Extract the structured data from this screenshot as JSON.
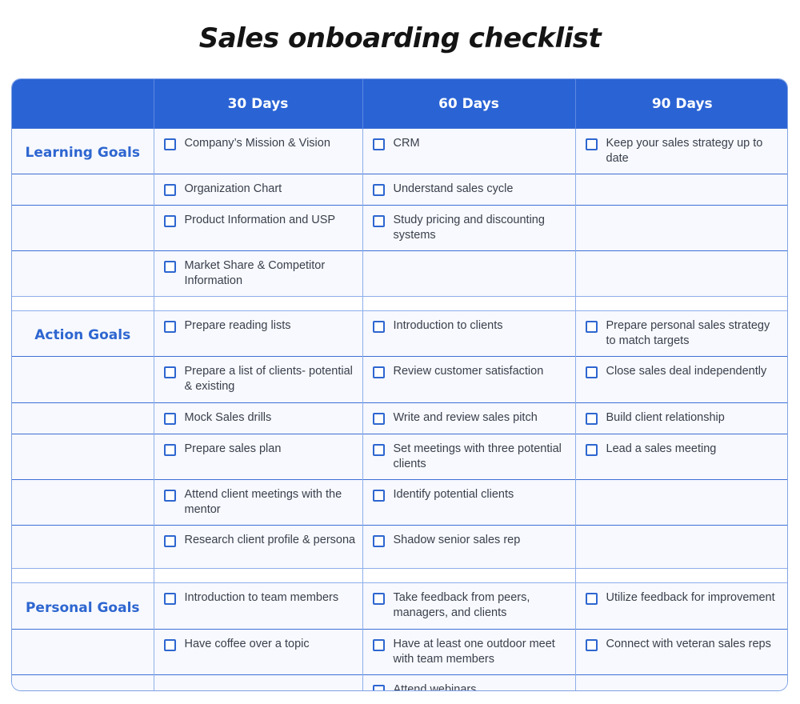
{
  "title": "Sales onboarding checklist",
  "columns": [
    "",
    "30 Days",
    "60 Days",
    "90 Days"
  ],
  "groups": [
    {
      "label": "Learning Goals",
      "rows": [
        [
          "Company’s Mission & Vision",
          "CRM",
          "Keep your sales strategy up to date"
        ],
        [
          "Organization Chart",
          "Understand sales cycle",
          ""
        ],
        [
          "Product Information and USP",
          "Study pricing and discounting systems",
          ""
        ],
        [
          "Market Share & Competitor Information",
          "",
          ""
        ]
      ]
    },
    {
      "label": "Action Goals",
      "rows": [
        [
          "Prepare reading lists",
          "Introduction to clients",
          "Prepare personal sales strategy to match targets"
        ],
        [
          "Prepare a list of clients- potential & existing",
          "Review customer satisfaction",
          "Close sales deal independently"
        ],
        [
          "Mock Sales drills",
          "Write and review sales pitch",
          "Build client relationship"
        ],
        [
          "Prepare sales plan",
          "Set meetings with three potential clients",
          "Lead a sales meeting"
        ],
        [
          "Attend client meetings with the mentor",
          "Identify potential clients",
          ""
        ],
        [
          "Research client profile & persona",
          "Shadow senior sales rep",
          ""
        ]
      ]
    },
    {
      "label": "Personal Goals",
      "rows": [
        [
          "Introduction to team members",
          "Take feedback from peers, managers, and clients",
          "Utilize feedback for improvement"
        ],
        [
          "Have coffee over a topic",
          "Have at least one outdoor meet with team members",
          "Connect with veteran sales reps"
        ],
        [
          "",
          "Attend webinars",
          ""
        ]
      ]
    }
  ],
  "colors": {
    "header_bg": "#2a63d4",
    "label_text": "#2e66d0",
    "checkbox": "#2e66d0",
    "row_bg": "#f7f9fe"
  }
}
